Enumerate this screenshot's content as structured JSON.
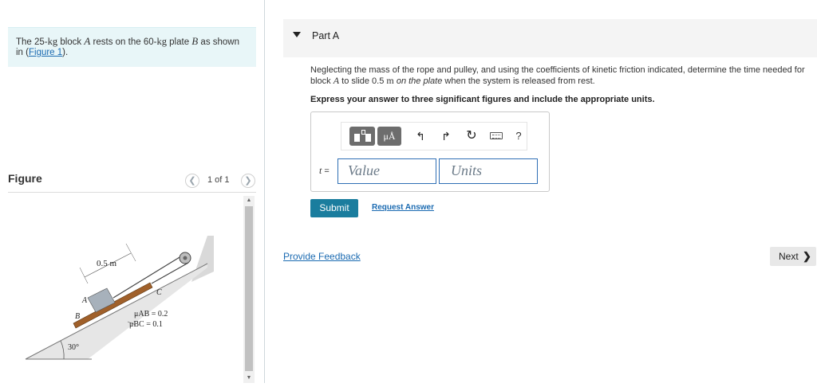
{
  "problem": {
    "prefix": "The 25-",
    "mass_a_unit": "kg",
    "mid1": " block ",
    "block_a": "A",
    "mid2": " rests on the 60-",
    "mass_b_unit": "kg",
    "mid3": " plate ",
    "plate_b": "B",
    "mid4": " as shown",
    "line2_prefix": "in (",
    "figure_link": "Figure 1",
    "line2_suffix": ")."
  },
  "figure_panel": {
    "title": "Figure",
    "pager_text": "1 of 1",
    "prev_icon": "chevron-left-icon",
    "next_icon": "chevron-right-icon",
    "diagram": {
      "distance_label": "0.5 m",
      "label_a": "A",
      "label_b": "B",
      "label_c": "C",
      "mu_ab": "μAB = 0.2",
      "mu_bc": "μBC = 0.1",
      "angle_label": "30°"
    }
  },
  "part_a": {
    "title": "Part A",
    "question": {
      "s1": "Neglecting the mass of the rope and pulley, and using the coefficients of kinetic friction indicated, determine the time needed for",
      "s2": "block ",
      "block": "A",
      "s3": " to slide 0.5 ",
      "unit": "m",
      "s4": " ",
      "on_plate": "on the plate",
      "s5": " when the system is released from rest."
    },
    "instructions": "Express your answer to three significant figures and include the appropriate units.",
    "toolbar": {
      "units_button": "μÅ",
      "undo_glyph": "↰",
      "redo_glyph": "↱",
      "reset_glyph": "↻",
      "help_glyph": "?"
    },
    "answer": {
      "variable": "t",
      "equals": " =",
      "value_placeholder": "Value",
      "units_placeholder": "Units"
    },
    "submit_label": "Submit",
    "request_answer_label": "Request Answer"
  },
  "footer": {
    "feedback_label": "Provide Feedback",
    "next_label": "Next",
    "next_glyph": "❯"
  },
  "colors": {
    "accent": "#1a7d9e",
    "link": "#1a6ab1",
    "problem_bg": "#e8f6f8",
    "plate": "#a0602a"
  }
}
